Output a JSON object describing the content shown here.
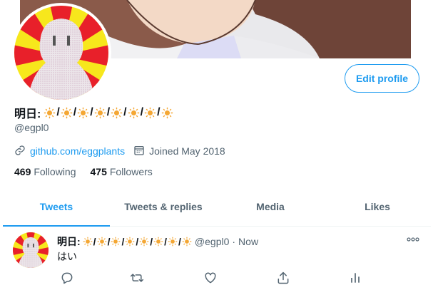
{
  "profile": {
    "name_prefix": "明日:",
    "name_suns": 8,
    "name_separator": "/",
    "handle": "@egpl0",
    "website": "github.com/eggplants",
    "joined": "Joined May 2018",
    "following_count": "469",
    "following_label": "Following",
    "followers_count": "475",
    "followers_label": "Followers",
    "edit_label": "Edit profile"
  },
  "tabs": [
    {
      "label": "Tweets",
      "active": true
    },
    {
      "label": "Tweets & replies",
      "active": false
    },
    {
      "label": "Media",
      "active": false
    },
    {
      "label": "Likes",
      "active": false
    }
  ],
  "tweet": {
    "name_prefix": "明日:",
    "handle": "@egpl0",
    "dot": "·",
    "time": "Now",
    "text": "はい",
    "more": "ooo"
  },
  "colors": {
    "accent": "#1d9bf0",
    "secondary_text": "#536471",
    "sun": "#f4a734",
    "avatar_red": "#e8202a",
    "avatar_yellow": "#f7e71c"
  },
  "icons": {
    "link": "link-icon",
    "calendar": "calendar-icon",
    "reply": "reply-icon",
    "retweet": "retweet-icon",
    "like": "like-icon",
    "share": "share-icon",
    "analytics": "analytics-icon",
    "more": "more-icon"
  }
}
